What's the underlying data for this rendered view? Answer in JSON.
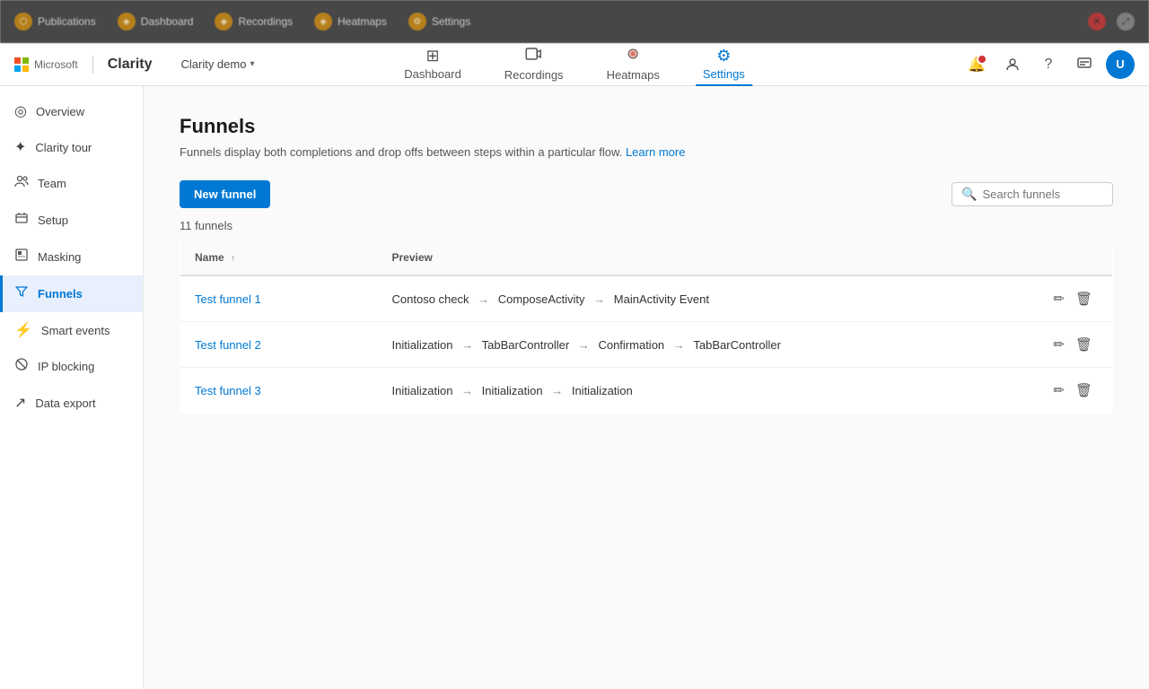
{
  "topOverlay": {
    "visible": true
  },
  "header": {
    "microsoft_label": "Microsoft",
    "app_name": "Clarity",
    "project_name": "Clarity demo",
    "nav": [
      {
        "id": "dashboard",
        "label": "Dashboard",
        "icon": "⊞",
        "active": false
      },
      {
        "id": "recordings",
        "label": "Recordings",
        "icon": "▶",
        "active": false
      },
      {
        "id": "heatmaps",
        "label": "Heatmaps",
        "icon": "🔥",
        "active": false
      },
      {
        "id": "settings",
        "label": "Settings",
        "icon": "⚙",
        "active": true
      }
    ]
  },
  "sidebar": {
    "items": [
      {
        "id": "overview",
        "label": "Overview",
        "icon": "◎",
        "active": false
      },
      {
        "id": "clarity-tour",
        "label": "Clarity tour",
        "icon": "✦",
        "active": false
      },
      {
        "id": "team",
        "label": "Team",
        "icon": "👥",
        "active": false
      },
      {
        "id": "setup",
        "label": "Setup",
        "icon": "{}",
        "active": false
      },
      {
        "id": "masking",
        "label": "Masking",
        "icon": "◫",
        "active": false
      },
      {
        "id": "funnels",
        "label": "Funnels",
        "icon": "⋮",
        "active": true
      },
      {
        "id": "smart-events",
        "label": "Smart events",
        "icon": "⚡",
        "active": false
      },
      {
        "id": "ip-blocking",
        "label": "IP blocking",
        "icon": "⊘",
        "active": false
      },
      {
        "id": "data-export",
        "label": "Data export",
        "icon": "↗",
        "active": false
      }
    ]
  },
  "main": {
    "title": "Funnels",
    "description": "Funnels display both completions and drop offs between steps within a particular flow.",
    "learn_more_label": "Learn more",
    "new_funnel_label": "New funnel",
    "search_placeholder": "Search funnels",
    "count_label": "11 funnels",
    "table": {
      "columns": [
        {
          "id": "name",
          "label": "Name",
          "sortable": true
        },
        {
          "id": "preview",
          "label": "Preview",
          "sortable": false
        }
      ],
      "rows": [
        {
          "id": "funnel-1",
          "name": "Test funnel 1",
          "preview_steps": [
            "Contoso check",
            "ComposeActivity",
            "MainActivity Event"
          ]
        },
        {
          "id": "funnel-2",
          "name": "Test funnel 2",
          "preview_steps": [
            "Initialization",
            "TabBarController",
            "Confirmation",
            "TabBarController"
          ]
        },
        {
          "id": "funnel-3",
          "name": "Test funnel 3",
          "preview_steps": [
            "Initialization",
            "Initialization",
            "Initialization"
          ]
        }
      ]
    }
  },
  "icons": {
    "search": "🔍",
    "edit": "✏",
    "delete": "🗑",
    "chevron_down": "▾",
    "notification": "🔔",
    "people": "👤",
    "question": "?",
    "feedback": "📋"
  },
  "colors": {
    "primary": "#0078d4",
    "active_bg": "#e8f0fe",
    "active_border": "#0078d4"
  }
}
